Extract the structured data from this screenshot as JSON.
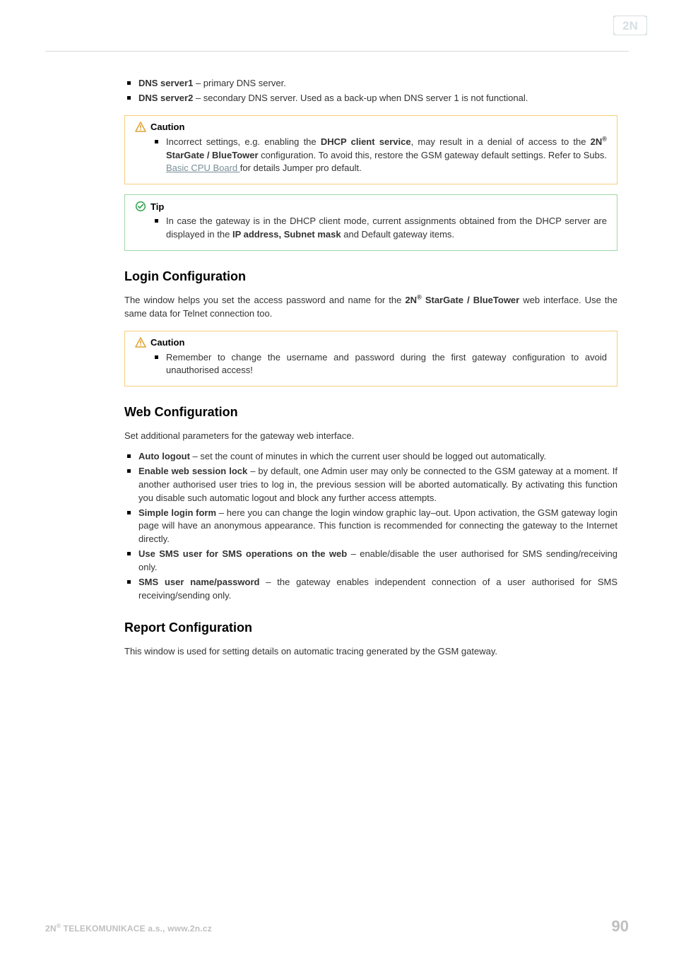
{
  "brand": {
    "name": "2N"
  },
  "intro_list": [
    {
      "term": "DNS server1",
      "rest": " – primary DNS server."
    },
    {
      "term": "DNS server2",
      "rest": " – secondary DNS server. Used as a back-up when DNS server 1 is not functional."
    }
  ],
  "callout1": {
    "title": "Caution",
    "item": {
      "pre": "Incorrect settings, e.g. enabling the ",
      "bold1": "DHCP client service",
      "mid1": ", may result in a denial of access to the ",
      "bold2_pre": "2N",
      "bold2_sup": "®",
      "bold2_post": " StarGate / BlueTower",
      "mid2": " configuration. To avoid this, restore the GSM gateway default settings. Refer to Subs. ",
      "link": "Basic CPU Board ",
      "post": "for details Jumper pro default."
    }
  },
  "callout2": {
    "title": "Tip",
    "item": {
      "pre": "In case the gateway is in the DHCP client mode, current assignments obtained from the DHCP server are displayed in the ",
      "bold": "IP address, Subnet mask",
      "post": " and Default gateway items."
    }
  },
  "login": {
    "heading": "Login Configuration",
    "para": {
      "pre": "The window helps you set the access password and name for the ",
      "bold_pre": "2N",
      "bold_sup": "®",
      "bold_post": " StarGate / BlueTower",
      "post": " web interface. Use the same data for Telnet connection too."
    }
  },
  "callout3": {
    "title": "Caution",
    "item": "Remember to change the username and password during the first gateway configuration to avoid unauthorised access!"
  },
  "web": {
    "heading": "Web Configuration",
    "para": "Set additional parameters for the gateway web interface.",
    "items": [
      {
        "term": "Auto logout",
        "rest": " – set the count of minutes in which the current user should be logged out automatically."
      },
      {
        "term": "Enable web session lock",
        "rest": " – by default, one Admin user may only be connected to the GSM gateway at a moment. If another authorised user tries to log in, the previous session will be aborted automatically. By activating this function you disable such automatic logout and block any further access attempts."
      },
      {
        "term": "Simple login form",
        "rest": " – here you can change the login window graphic lay–out. Upon activation, the GSM gateway login page will have an anonymous appearance. This function is recommended for connecting the gateway to the Internet directly."
      },
      {
        "term": "Use SMS user for SMS operations on the web",
        "rest": " – enable/disable the user authorised for SMS sending/receiving only."
      },
      {
        "term": "SMS user name/password",
        "rest": " – the gateway enables independent connection of a user authorised for SMS receiving/sending only."
      }
    ]
  },
  "report": {
    "heading": "Report Configuration",
    "para": "This window is used for setting details on automatic tracing generated by the GSM gateway."
  },
  "footer": {
    "left_pre": "2N",
    "left_sup": "®",
    "left_post": " TELEKOMUNIKACE a.s., www.2n.cz",
    "page": "90"
  }
}
